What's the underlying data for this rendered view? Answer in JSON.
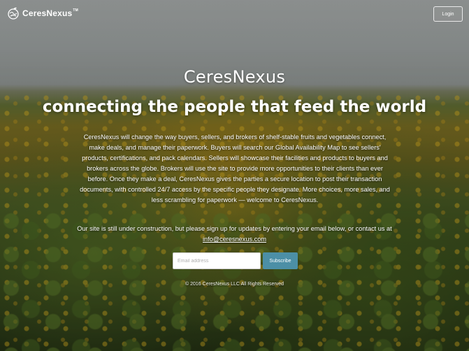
{
  "header": {
    "logo_text": "CeresNexus",
    "logo_tm": "TM",
    "logo_icon": "globe-leaf-icon",
    "login_label": "Login"
  },
  "hero": {
    "brand_title": "CeresNexus",
    "tagline": "connecting the people that feed the world",
    "description": "CeresNexus will change the way buyers, sellers, and brokers of shelf-stable fruits and vegetables connect, make deals, and manage their paperwork. Buyers will search our Global Availability Map to see sellers' products, certifications, and pack calendars. Sellers will showcase their facilities and products to buyers and brokers across the globe. Brokers will use the site to provide more opportunities to their clients than ever before. Once they make a deal, CeresNexus gives the parties a secure location to post their transaction documents, with controlled 24/7 access by the specific people they designate. More choices, more sales, and less scrambling for paperwork — welcome to CeresNexus.",
    "signup_note_prefix": "Our site is still under construction, but please sign up for updates by entering your email below, or contact us at ",
    "contact_email": "info@ceresnexus.com"
  },
  "form": {
    "email_placeholder": "Email address",
    "subscribe_label": "Subscribe"
  },
  "footer": {
    "copyright": "© 2016 CeresNexus LLC All Rights Reserved"
  },
  "colors": {
    "accent": "#4c8fa6",
    "text": "#ffffff"
  }
}
